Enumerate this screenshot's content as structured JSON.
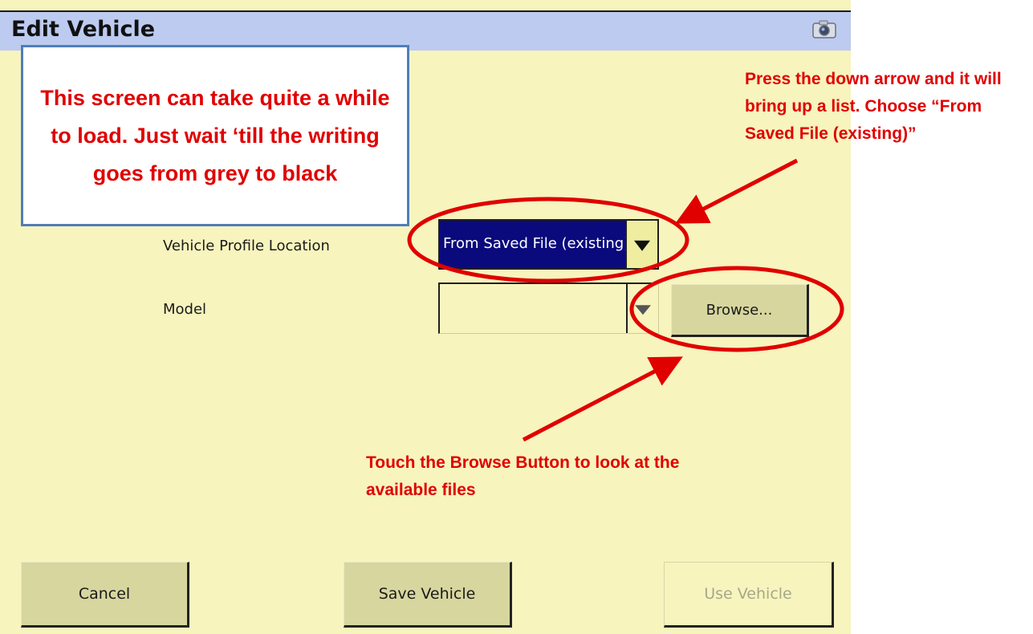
{
  "window": {
    "title": "Edit Vehicle",
    "camera_icon": "camera-icon"
  },
  "form": {
    "profile_location_label": "Vehicle Profile Location",
    "profile_location_value": "From Saved File (existing)",
    "model_label": "Model",
    "model_value": "",
    "browse_label": "Browse..."
  },
  "footer": {
    "cancel_label": "Cancel",
    "save_label": "Save Vehicle",
    "use_label": "Use Vehicle"
  },
  "annotations": {
    "loading_note": "This screen can take quite a while to load.  Just wait ‘till the writing goes from grey to black",
    "dropdown_note": "Press the down arrow and it will bring up a list.  Choose “From Saved File (existing)”",
    "browse_note": "Touch the Browse Button to look at the available files"
  },
  "colors": {
    "background": "#f7f4be",
    "titlebar": "#bccbef",
    "selected": "#0a0a7d",
    "annotation": "#e00000",
    "note_border": "#4f7fb7"
  }
}
